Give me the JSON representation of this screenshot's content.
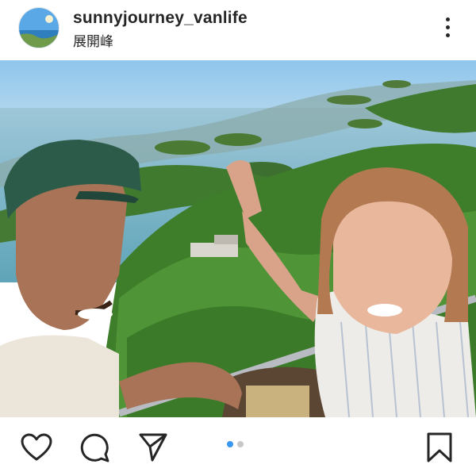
{
  "post": {
    "username": "sunnyjourney_vanlife",
    "location": "展開峰"
  },
  "header": {
    "avatar_icon": "profile-avatar-icon",
    "more_icon": "more-options-icon"
  },
  "photo": {
    "description_icon": "selfie-photo"
  },
  "actions": {
    "like_icon": "heart-icon",
    "comment_icon": "comment-icon",
    "share_icon": "send-icon",
    "save_icon": "bookmark-icon"
  },
  "carousel": {
    "current": 1,
    "total": 2,
    "active_color": "#3897f0",
    "inactive_color": "#c7c7c7"
  }
}
